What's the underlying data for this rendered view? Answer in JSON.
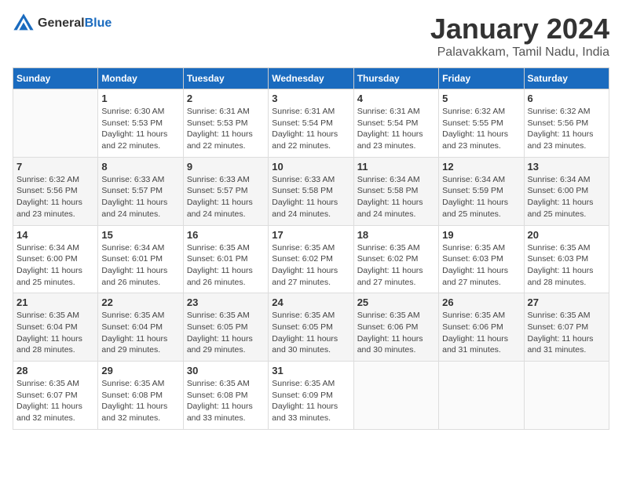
{
  "header": {
    "logo": {
      "text_general": "General",
      "text_blue": "Blue"
    },
    "title": "January 2024",
    "subtitle": "Palavakkam, Tamil Nadu, India"
  },
  "calendar": {
    "days_of_week": [
      "Sunday",
      "Monday",
      "Tuesday",
      "Wednesday",
      "Thursday",
      "Friday",
      "Saturday"
    ],
    "weeks": [
      [
        {
          "day": "",
          "info": ""
        },
        {
          "day": "1",
          "info": "Sunrise: 6:30 AM\nSunset: 5:53 PM\nDaylight: 11 hours\nand 22 minutes."
        },
        {
          "day": "2",
          "info": "Sunrise: 6:31 AM\nSunset: 5:53 PM\nDaylight: 11 hours\nand 22 minutes."
        },
        {
          "day": "3",
          "info": "Sunrise: 6:31 AM\nSunset: 5:54 PM\nDaylight: 11 hours\nand 22 minutes."
        },
        {
          "day": "4",
          "info": "Sunrise: 6:31 AM\nSunset: 5:54 PM\nDaylight: 11 hours\nand 23 minutes."
        },
        {
          "day": "5",
          "info": "Sunrise: 6:32 AM\nSunset: 5:55 PM\nDaylight: 11 hours\nand 23 minutes."
        },
        {
          "day": "6",
          "info": "Sunrise: 6:32 AM\nSunset: 5:56 PM\nDaylight: 11 hours\nand 23 minutes."
        }
      ],
      [
        {
          "day": "7",
          "info": "Sunrise: 6:32 AM\nSunset: 5:56 PM\nDaylight: 11 hours\nand 23 minutes."
        },
        {
          "day": "8",
          "info": "Sunrise: 6:33 AM\nSunset: 5:57 PM\nDaylight: 11 hours\nand 24 minutes."
        },
        {
          "day": "9",
          "info": "Sunrise: 6:33 AM\nSunset: 5:57 PM\nDaylight: 11 hours\nand 24 minutes."
        },
        {
          "day": "10",
          "info": "Sunrise: 6:33 AM\nSunset: 5:58 PM\nDaylight: 11 hours\nand 24 minutes."
        },
        {
          "day": "11",
          "info": "Sunrise: 6:34 AM\nSunset: 5:58 PM\nDaylight: 11 hours\nand 24 minutes."
        },
        {
          "day": "12",
          "info": "Sunrise: 6:34 AM\nSunset: 5:59 PM\nDaylight: 11 hours\nand 25 minutes."
        },
        {
          "day": "13",
          "info": "Sunrise: 6:34 AM\nSunset: 6:00 PM\nDaylight: 11 hours\nand 25 minutes."
        }
      ],
      [
        {
          "day": "14",
          "info": "Sunrise: 6:34 AM\nSunset: 6:00 PM\nDaylight: 11 hours\nand 25 minutes."
        },
        {
          "day": "15",
          "info": "Sunrise: 6:34 AM\nSunset: 6:01 PM\nDaylight: 11 hours\nand 26 minutes."
        },
        {
          "day": "16",
          "info": "Sunrise: 6:35 AM\nSunset: 6:01 PM\nDaylight: 11 hours\nand 26 minutes."
        },
        {
          "day": "17",
          "info": "Sunrise: 6:35 AM\nSunset: 6:02 PM\nDaylight: 11 hours\nand 27 minutes."
        },
        {
          "day": "18",
          "info": "Sunrise: 6:35 AM\nSunset: 6:02 PM\nDaylight: 11 hours\nand 27 minutes."
        },
        {
          "day": "19",
          "info": "Sunrise: 6:35 AM\nSunset: 6:03 PM\nDaylight: 11 hours\nand 27 minutes."
        },
        {
          "day": "20",
          "info": "Sunrise: 6:35 AM\nSunset: 6:03 PM\nDaylight: 11 hours\nand 28 minutes."
        }
      ],
      [
        {
          "day": "21",
          "info": "Sunrise: 6:35 AM\nSunset: 6:04 PM\nDaylight: 11 hours\nand 28 minutes."
        },
        {
          "day": "22",
          "info": "Sunrise: 6:35 AM\nSunset: 6:04 PM\nDaylight: 11 hours\nand 29 minutes."
        },
        {
          "day": "23",
          "info": "Sunrise: 6:35 AM\nSunset: 6:05 PM\nDaylight: 11 hours\nand 29 minutes."
        },
        {
          "day": "24",
          "info": "Sunrise: 6:35 AM\nSunset: 6:05 PM\nDaylight: 11 hours\nand 30 minutes."
        },
        {
          "day": "25",
          "info": "Sunrise: 6:35 AM\nSunset: 6:06 PM\nDaylight: 11 hours\nand 30 minutes."
        },
        {
          "day": "26",
          "info": "Sunrise: 6:35 AM\nSunset: 6:06 PM\nDaylight: 11 hours\nand 31 minutes."
        },
        {
          "day": "27",
          "info": "Sunrise: 6:35 AM\nSunset: 6:07 PM\nDaylight: 11 hours\nand 31 minutes."
        }
      ],
      [
        {
          "day": "28",
          "info": "Sunrise: 6:35 AM\nSunset: 6:07 PM\nDaylight: 11 hours\nand 32 minutes."
        },
        {
          "day": "29",
          "info": "Sunrise: 6:35 AM\nSunset: 6:08 PM\nDaylight: 11 hours\nand 32 minutes."
        },
        {
          "day": "30",
          "info": "Sunrise: 6:35 AM\nSunset: 6:08 PM\nDaylight: 11 hours\nand 33 minutes."
        },
        {
          "day": "31",
          "info": "Sunrise: 6:35 AM\nSunset: 6:09 PM\nDaylight: 11 hours\nand 33 minutes."
        },
        {
          "day": "",
          "info": ""
        },
        {
          "day": "",
          "info": ""
        },
        {
          "day": "",
          "info": ""
        }
      ]
    ]
  }
}
